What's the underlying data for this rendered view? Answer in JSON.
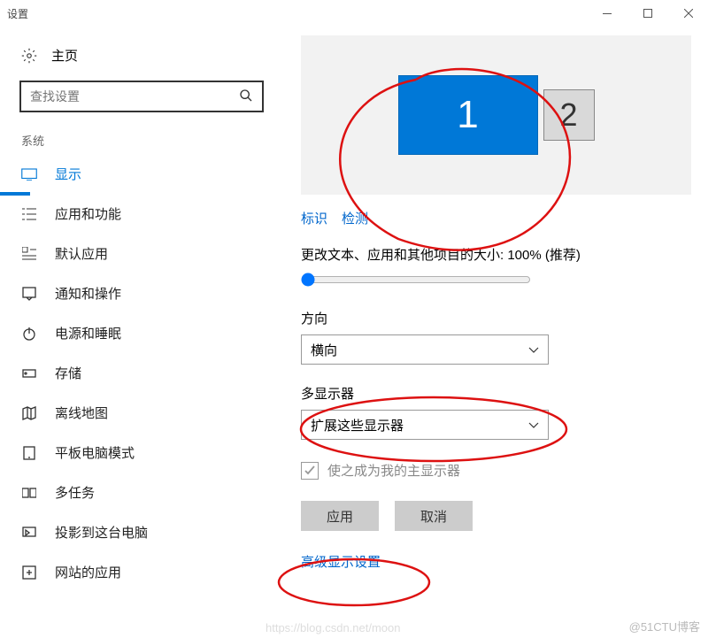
{
  "titlebar": {
    "title": "设置"
  },
  "sidebar": {
    "home": "主页",
    "search_placeholder": "查找设置",
    "category": "系统",
    "items": [
      {
        "label": "显示"
      },
      {
        "label": "应用和功能"
      },
      {
        "label": "默认应用"
      },
      {
        "label": "通知和操作"
      },
      {
        "label": "电源和睡眠"
      },
      {
        "label": "存储"
      },
      {
        "label": "离线地图"
      },
      {
        "label": "平板电脑模式"
      },
      {
        "label": "多任务"
      },
      {
        "label": "投影到这台电脑"
      },
      {
        "label": "网站的应用"
      }
    ]
  },
  "content": {
    "monitor1": "1",
    "monitor2": "2",
    "identify": "标识",
    "detect": "检测",
    "scale_label": "更改文本、应用和其他项目的大小: 100% (推荐)",
    "orientation_label": "方向",
    "orientation_value": "横向",
    "multi_label": "多显示器",
    "multi_value": "扩展这些显示器",
    "primary_checkbox": "使之成为我的主显示器",
    "apply": "应用",
    "cancel": "取消",
    "advanced": "高级显示设置"
  },
  "watermark": "@51CTU博客",
  "watermark2": "https://blog.csdn.net/moon"
}
